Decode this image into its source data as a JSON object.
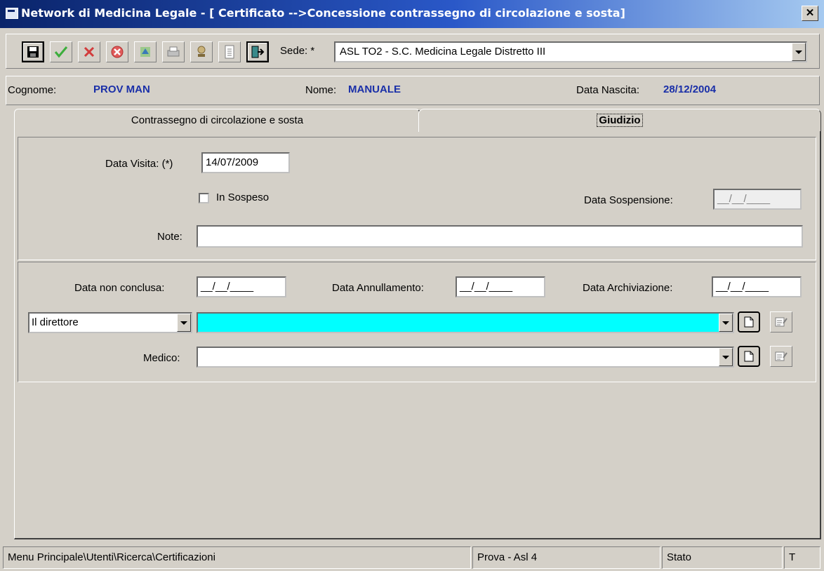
{
  "window": {
    "title": "Network di Medicina Legale - [ Certificato -->Concessione contrassegno di circolazione e sosta]",
    "close_glyph": "✕"
  },
  "toolbar": {
    "sede_label": "Sede: *",
    "sede_value": "ASL TO2 - S.C. Medicina Legale Distretto III",
    "buttons": [
      "save-icon",
      "confirm-icon",
      "cancel-icon",
      "delete-icon",
      "refresh-icon",
      "print-icon",
      "stamp-icon",
      "document-icon",
      "exit-icon"
    ]
  },
  "patient": {
    "cognome_label": "Cognome:",
    "cognome_value": "PROV MAN",
    "nome_label": "Nome:",
    "nome_value": "MANUALE",
    "nascita_label": "Data Nascita:",
    "nascita_value": "28/12/2004"
  },
  "tabs": [
    {
      "label": "Contrassegno di circolazione e sosta",
      "active": false
    },
    {
      "label": "Giudizio",
      "active": true
    }
  ],
  "form": {
    "data_visita_label": "Data Visita: (*)",
    "data_visita_value": "14/07/2009",
    "in_sospeso_label": "In Sospeso",
    "data_sospensione_label": "Data Sospensione:",
    "data_sospensione_value": "__/__/____",
    "note_label": "Note:",
    "note_value": "",
    "data_non_conclusa_label": "Data non conclusa:",
    "data_non_conclusa_value": "__/__/____",
    "data_annullamento_label": "Data Annullamento:",
    "data_annullamento_value": "__/__/____",
    "data_archiviazione_label": "Data Archiviazione:",
    "data_archiviazione_value": "__/__/____",
    "direttore_select": "Il direttore",
    "direttore_value": "",
    "medico_label": "Medico:",
    "medico_value": ""
  },
  "status_bar": {
    "path": "Menu Principale\\Utenti\\Ricerca\\Certificazioni",
    "user": "Prova - Asl 4",
    "state": "Stato",
    "extra": "T"
  },
  "colors": {
    "highlight_field": "#00ffff",
    "title_bar": "#0a246a",
    "value_text": "#1a2fa8"
  }
}
